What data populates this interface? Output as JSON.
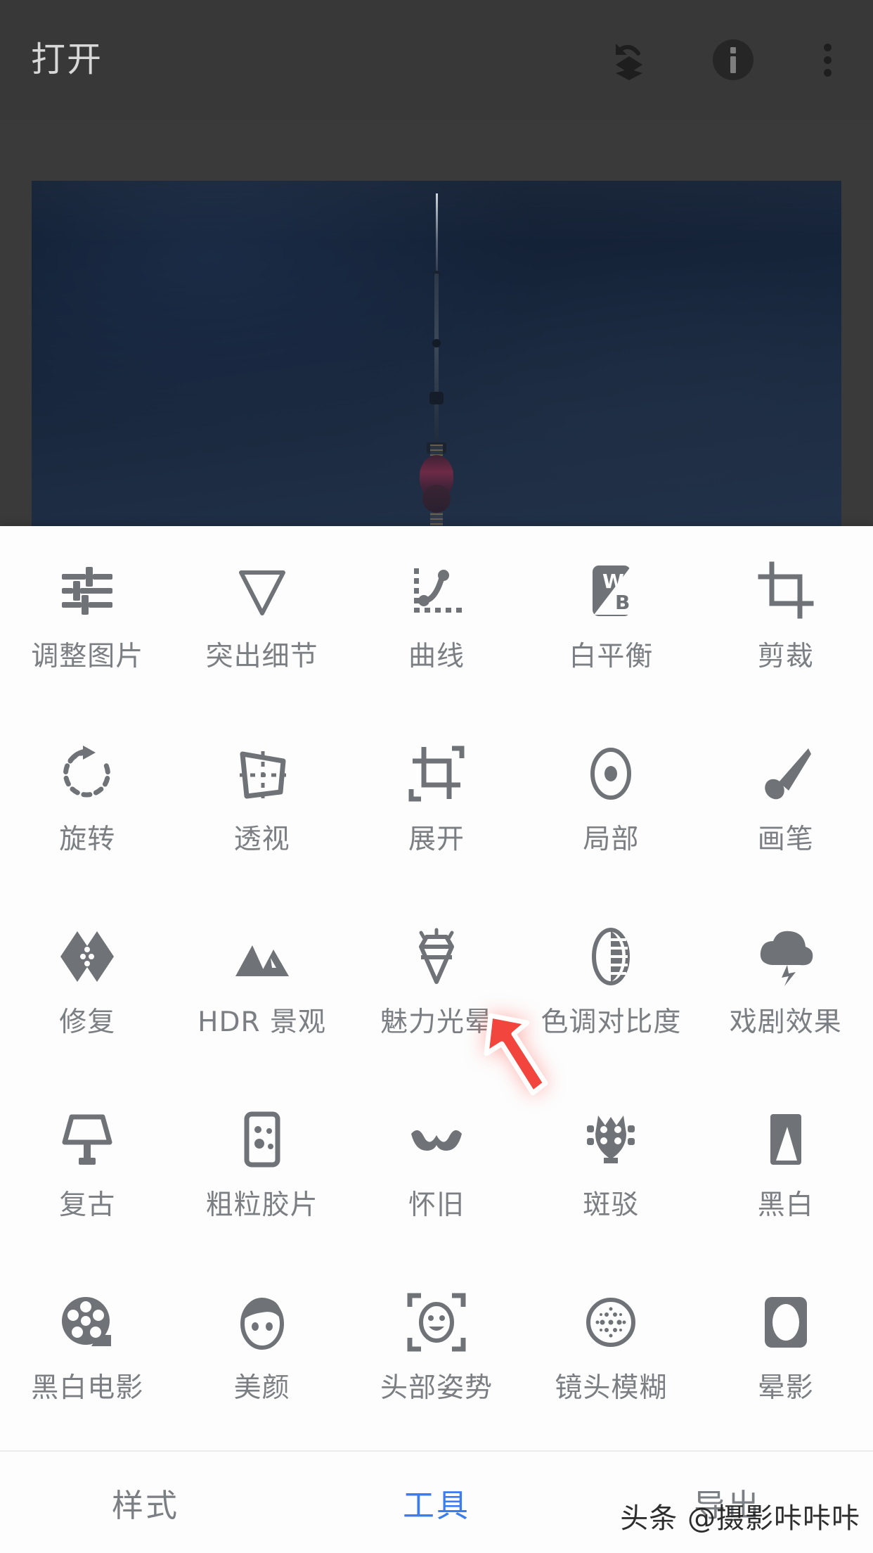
{
  "app": {
    "header": {
      "title": "打开",
      "icons": [
        {
          "name": "undo-layers-icon",
          "glyph": "undo-layers"
        },
        {
          "name": "info-icon",
          "glyph": "info"
        },
        {
          "name": "overflow-menu-icon",
          "glyph": "three-dots"
        }
      ]
    },
    "photo": {
      "subject": "夜空中的电视塔"
    },
    "tools": [
      {
        "label": "调整图片",
        "icon": "sliders-icon"
      },
      {
        "label": "突出细节",
        "icon": "triangle-detail-icon"
      },
      {
        "label": "曲线",
        "icon": "curve-icon"
      },
      {
        "label": "白平衡",
        "icon": "white-balance-icon"
      },
      {
        "label": "剪裁",
        "icon": "crop-icon"
      },
      {
        "label": "旋转",
        "icon": "rotate-icon"
      },
      {
        "label": "透视",
        "icon": "perspective-icon"
      },
      {
        "label": "展开",
        "icon": "expand-icon"
      },
      {
        "label": "局部",
        "icon": "selective-icon"
      },
      {
        "label": "画笔",
        "icon": "brush-icon"
      },
      {
        "label": "修复",
        "icon": "healing-icon"
      },
      {
        "label": "HDR 景观",
        "icon": "hdr-landscape-icon"
      },
      {
        "label": "魅力光晕",
        "icon": "glamour-glow-icon"
      },
      {
        "label": "色调对比度",
        "icon": "tonal-contrast-icon"
      },
      {
        "label": "戏剧效果",
        "icon": "drama-icon"
      },
      {
        "label": "复古",
        "icon": "vintage-lamp-icon"
      },
      {
        "label": "粗粒胶片",
        "icon": "grainy-film-icon"
      },
      {
        "label": "怀旧",
        "icon": "retrolux-icon"
      },
      {
        "label": "斑驳",
        "icon": "grunge-icon"
      },
      {
        "label": "黑白",
        "icon": "black-white-icon"
      },
      {
        "label": "黑白电影",
        "icon": "noir-film-reel-icon"
      },
      {
        "label": "美颜",
        "icon": "portrait-face-icon"
      },
      {
        "label": "头部姿势",
        "icon": "head-pose-icon"
      },
      {
        "label": "镜头模糊",
        "icon": "lens-blur-icon"
      },
      {
        "label": "晕影",
        "icon": "vignette-icon"
      }
    ],
    "bottom_nav": {
      "items": [
        {
          "label": "样式",
          "active": false
        },
        {
          "label": "工具",
          "active": true
        },
        {
          "label": "导出",
          "active": false
        }
      ],
      "active_color": "#3b7cf0"
    },
    "cursor": {
      "name": "red-pointer-arrow",
      "color": "#f2453d",
      "points_at": "魅力光晕"
    },
    "watermark": {
      "text": "头条 @摄影咔咔咔"
    }
  }
}
